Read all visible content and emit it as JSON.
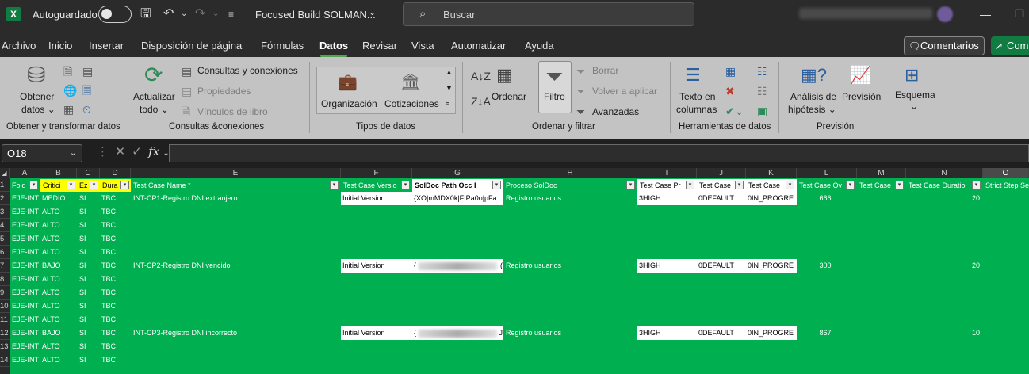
{
  "title_bar": {
    "app_icon": "X",
    "autosave_label": "Autoguardado",
    "file_name": "Focused Build SOLMAN...",
    "search_placeholder": "Buscar",
    "icons": [
      "save-icon",
      "undo-icon",
      "redo-icon",
      "customize-icon",
      "search-icon"
    ]
  },
  "tabs": [
    "Archivo",
    "Inicio",
    "Insertar",
    "Disposición de página",
    "Fórmulas",
    "Datos",
    "Revisar",
    "Vista",
    "Automatizar",
    "Ayuda"
  ],
  "active_tab": "Datos",
  "comments_button": "Comentarios",
  "share_button": "Com",
  "ribbon": {
    "group1": {
      "label": "Obtener y transformar datos",
      "obtener": "Obtener",
      "datos": "datos"
    },
    "group2": {
      "label": "Consultas &conexiones",
      "actualizar": "Actualizar",
      "todo": "todo",
      "consultas": "Consultas y conexiones",
      "propiedades": "Propiedades",
      "vinculos": "Vínculos de libro"
    },
    "group3": {
      "label": "Tipos de datos",
      "organizacion": "Organización",
      "cotizaciones": "Cotizaciones"
    },
    "group4": {
      "label": "Ordenar y filtrar",
      "ordenar": "Ordenar",
      "filtro": "Filtro",
      "borrar": "Borrar",
      "volver": "Volver a aplicar",
      "avanzadas": "Avanzadas"
    },
    "group5": {
      "label": "Herramientas de datos",
      "texto": "Texto en",
      "columnas": "columnas"
    },
    "group6": {
      "label": "Previsión",
      "analisis": "Análisis de",
      "hipotesis": "hipótesis",
      "prevision": "Previsión"
    },
    "group7": {
      "esquema": "Esquema"
    }
  },
  "formula_bar": {
    "name_box": "O18",
    "fx": "fx",
    "cancel": "✕",
    "enter": "✓"
  },
  "columns": [
    "A",
    "B",
    "C",
    "D",
    "E",
    "F",
    "G",
    "H",
    "I",
    "J",
    "K",
    "L",
    "M",
    "N",
    "O"
  ],
  "selected_column": "O",
  "rows": [
    "1",
    "2",
    "3",
    "4",
    "5",
    "6",
    "7",
    "8",
    "9",
    "10",
    "11",
    "12",
    "13",
    "14"
  ],
  "headers": {
    "A": "Fold",
    "B": "Critici",
    "C": "Ez",
    "D": "Dura",
    "E": "Test Case Name *",
    "F": "Test Case Versio",
    "G": "SolDoc Path Occ I",
    "H": "Proceso SolDoc",
    "I": "Test Case Pr",
    "J": "Test Case",
    "K": "Test Case",
    "L": "Test Case Ov",
    "M": "Test Case",
    "N": "Test Case Duratio",
    "O": "Strict Step Se"
  },
  "data_rows": [
    {
      "a": "EJE-INT",
      "b": "MEDIO",
      "c": "SI",
      "d": "TBC",
      "e": "INT-CP1-Registro DNI extranjero",
      "f": "Initial Version",
      "g": "{XO|mMDX0k|FIPa0o|pFa",
      "h": "Registro usuarios",
      "i": "3HIGH",
      "j": "0DEFAULT",
      "k": "0IN_PROGRE",
      "l": "666",
      "n": "20"
    },
    {
      "a": "EJE-INT",
      "b": "ALTO",
      "c": "SI",
      "d": "TBC"
    },
    {
      "a": "EJE-INT",
      "b": "ALTO",
      "c": "SI",
      "d": "TBC"
    },
    {
      "a": "EJE-INT",
      "b": "ALTO",
      "c": "SI",
      "d": "TBC"
    },
    {
      "a": "EJE-INT",
      "b": "ALTO",
      "c": "SI",
      "d": "TBC"
    },
    {
      "a": "EJE-INT",
      "b": "BAJO",
      "c": "SI",
      "d": "TBC",
      "e": "INT-CP2-Registro DNI vencido",
      "f": "Initial Version",
      "g": "{",
      "g_end": "(",
      "h": "Registro usuarios",
      "i": "3HIGH",
      "j": "0DEFAULT",
      "k": "0IN_PROGRE",
      "l": "300",
      "n": "20"
    },
    {
      "a": "EJE-INT",
      "b": "ALTO",
      "c": "SI",
      "d": "TBC"
    },
    {
      "a": "EJE-INT",
      "b": "ALTO",
      "c": "SI",
      "d": "TBC"
    },
    {
      "a": "EJE-INT",
      "b": "ALTO",
      "c": "SI",
      "d": "TBC"
    },
    {
      "a": "EJE-INT",
      "b": "ALTO",
      "c": "SI",
      "d": "TBC"
    },
    {
      "a": "EJE-INT",
      "b": "BAJO",
      "c": "SI",
      "d": "TBC",
      "e": "INT-CP3-Registro DNI incorrecto",
      "f": "Initial Version",
      "g": "{",
      "g_end": "J",
      "h": "Registro usuarios",
      "i": "3HIGH",
      "j": "0DEFAULT",
      "k": "0IN_PROGRE",
      "l": "867",
      "n": "10"
    },
    {
      "a": "EJE-INT",
      "b": "ALTO",
      "c": "SI",
      "d": "TBC"
    },
    {
      "a": "EJE-INT",
      "b": "ALTO",
      "c": "SI",
      "d": "TBC"
    }
  ]
}
